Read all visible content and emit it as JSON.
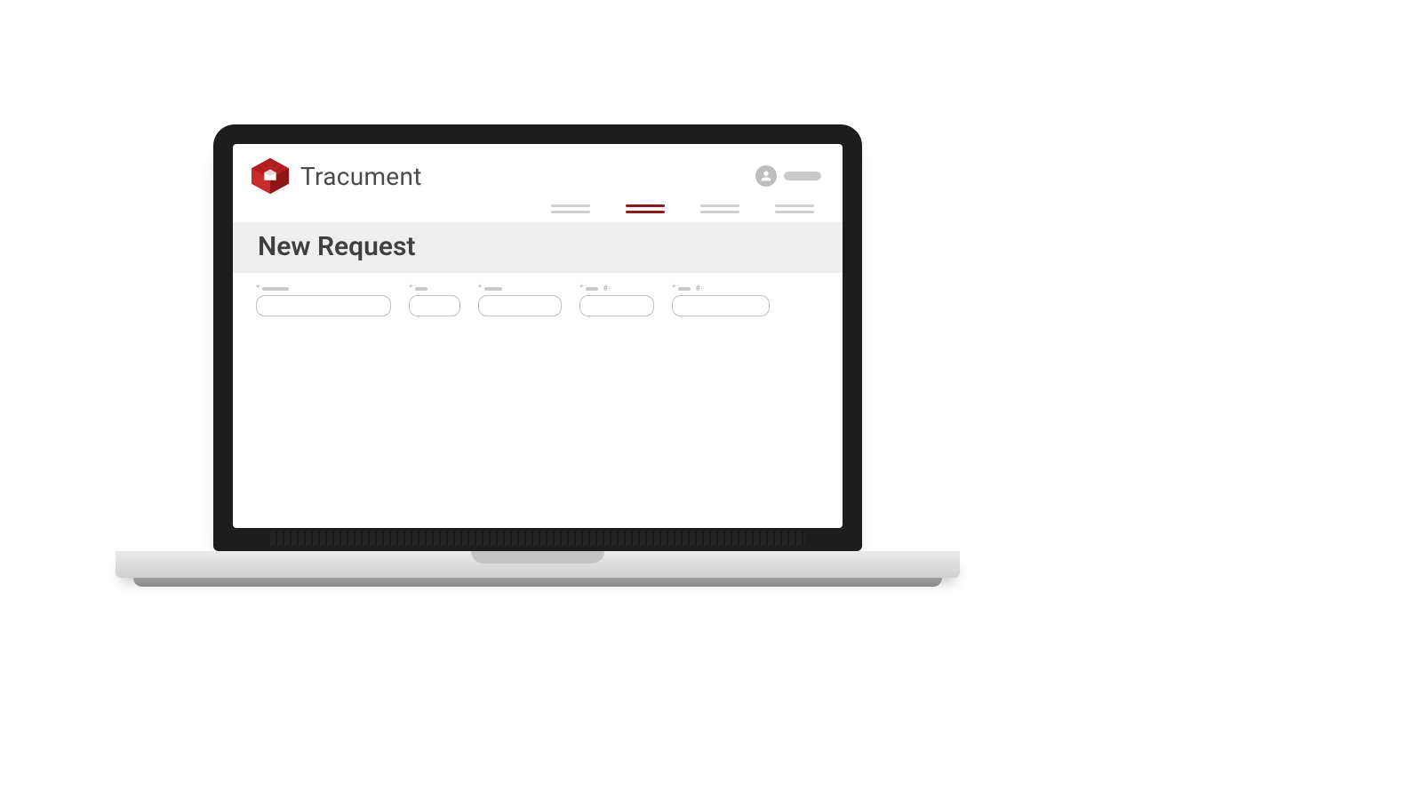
{
  "brand": {
    "name": "Tracument",
    "logo_color_primary": "#b21f1f",
    "logo_color_dark": "#7a1414",
    "logo_color_light": "#e85b5b"
  },
  "navbar": {
    "items": [
      {
        "id": "nav-1",
        "active": false
      },
      {
        "id": "nav-2",
        "active": true
      },
      {
        "id": "nav-3",
        "active": false
      },
      {
        "id": "nav-4",
        "active": false
      }
    ]
  },
  "page": {
    "title": "New Request"
  },
  "form": {
    "fields": [
      {
        "id": "field-1",
        "required": true,
        "label_suffix": "",
        "size": "lg"
      },
      {
        "id": "field-2",
        "required": true,
        "label_suffix": "",
        "size": "sm"
      },
      {
        "id": "field-3",
        "required": true,
        "label_suffix": "",
        "size": "md"
      },
      {
        "id": "field-4",
        "required": true,
        "label_suffix": "#",
        "size": "md2"
      },
      {
        "id": "field-5",
        "required": true,
        "label_suffix": "#",
        "size": "xl"
      }
    ]
  },
  "account": {
    "display_name_placeholder": ""
  }
}
